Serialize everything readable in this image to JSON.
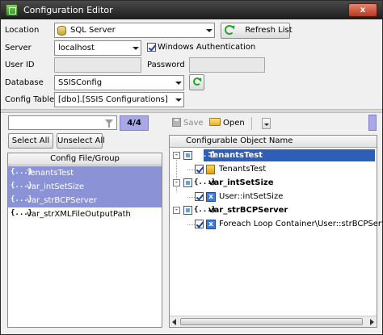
{
  "window": {
    "title": "Configuration Editor",
    "close_label": "x"
  },
  "form": {
    "location_label": "Location",
    "location_value": "SQL Server",
    "refresh_list_label": "Refresh List",
    "server_label": "Server",
    "server_value": "localhost",
    "windows_auth_label": "Windows Authentication",
    "windows_auth_checked": true,
    "user_id_label": "User ID",
    "user_id_value": "",
    "password_label": "Password",
    "password_value": "",
    "database_label": "Database",
    "database_value": "SSISConfig",
    "config_table_label": "Config Table",
    "config_table_value": "[dbo].[SSIS Configurations]"
  },
  "left_panel": {
    "filter_value": "",
    "count": "4/4",
    "select_all_label": "Select All",
    "unselect_all_label": "Unselect All",
    "column_header": "Config File/Group",
    "items": [
      {
        "brace": "{...}",
        "label": "TenantsTest",
        "selected": true
      },
      {
        "brace": "{...}",
        "label": "var_intSetSize",
        "selected": true
      },
      {
        "brace": "{...}",
        "label": "var_strBCPServer",
        "selected": true
      },
      {
        "brace": "{...}",
        "label": "var_strXMLFileOutputPath",
        "selected": false
      }
    ]
  },
  "right_panel": {
    "save_label": "Save",
    "open_label": "Open",
    "column_header": "Configurable Object Name",
    "tree": [
      {
        "group": "TenantsTest",
        "brace": "{...}",
        "selected": true,
        "child": {
          "label": "TenantsTest",
          "icon": "user-variable-icon"
        }
      },
      {
        "group": "var_intSetSize",
        "brace": "{...}",
        "selected": false,
        "child": {
          "label": "User::intSetSize",
          "icon": "variable-x-icon"
        }
      },
      {
        "group": "var_strBCPServer",
        "brace": "{...}",
        "selected": false,
        "child": {
          "label": "Foreach Loop Container\\User::strBCPServer",
          "icon": "variable-x-icon"
        }
      }
    ]
  },
  "colors": {
    "selection": "#8b93d6",
    "tree_selection": "#2d5fb7",
    "badge": "#a8a8e8"
  }
}
